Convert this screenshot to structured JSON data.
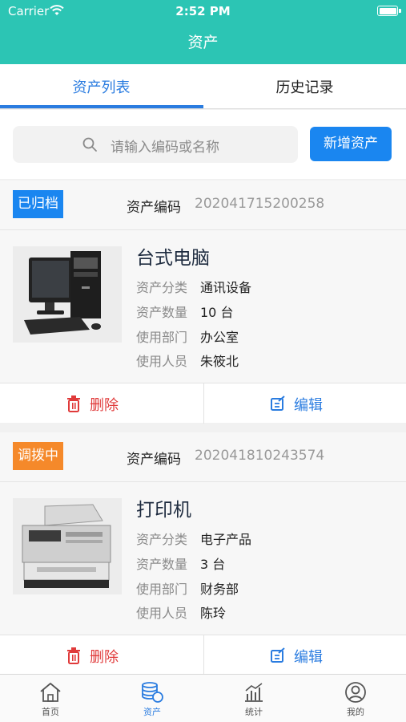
{
  "status_bar": {
    "carrier": "Carrier",
    "time": "2:52 PM"
  },
  "nav": {
    "title": "资产"
  },
  "tabs": [
    {
      "label": "资产列表",
      "active": true
    },
    {
      "label": "历史记录",
      "active": false
    }
  ],
  "search": {
    "placeholder": "请输入编码或名称",
    "add_button": "新增资产"
  },
  "labels": {
    "code": "资产编码",
    "category": "资产分类",
    "quantity": "资产数量",
    "department": "使用部门",
    "user": "使用人员",
    "delete": "删除",
    "edit": "编辑"
  },
  "assets": [
    {
      "status": "已归档",
      "status_color": "#1a86f0",
      "code": "202041715200258",
      "name": "台式电脑",
      "category": "通讯设备",
      "quantity": "10 台",
      "department": "办公室",
      "user": "朱筱北",
      "image": "desktop-computer"
    },
    {
      "status": "调拨中",
      "status_color": "#f5892a",
      "code": "202041810243574",
      "name": "打印机",
      "category": "电子产品",
      "quantity": "3 台",
      "department": "财务部",
      "user": "陈玲",
      "image": "printer"
    }
  ],
  "tabbar": [
    {
      "label": "首页",
      "icon": "home-icon",
      "active": false
    },
    {
      "label": "资产",
      "icon": "coins-icon",
      "active": true
    },
    {
      "label": "统计",
      "icon": "chart-icon",
      "active": false
    },
    {
      "label": "我的",
      "icon": "user-icon",
      "active": false
    }
  ],
  "colors": {
    "header": "#2cc5b4",
    "accent": "#2a7ce0",
    "danger": "#e03a3a"
  }
}
